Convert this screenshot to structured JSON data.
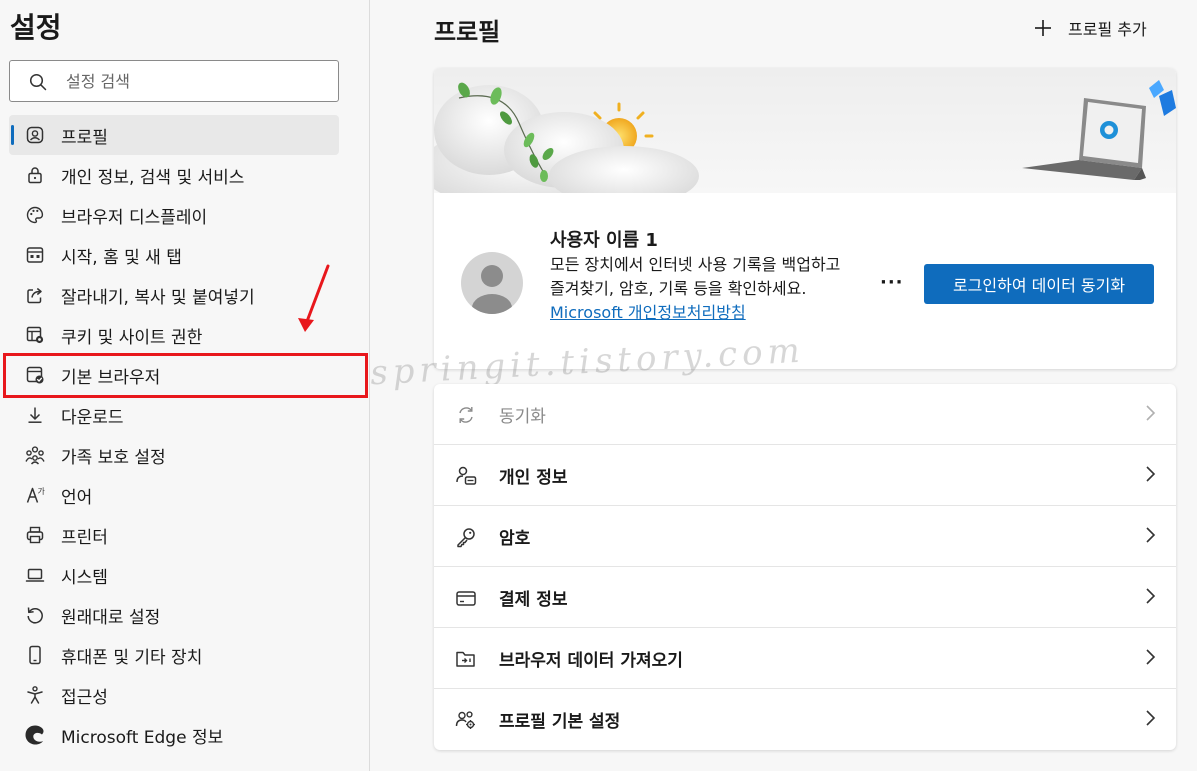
{
  "sidebar": {
    "title": "설정",
    "search": {
      "placeholder": "설정 검색",
      "value": ""
    },
    "items": [
      {
        "label": "프로필",
        "icon": "profile-icon",
        "active": true
      },
      {
        "label": "개인 정보, 검색 및 서비스",
        "icon": "lock-icon"
      },
      {
        "label": "브라우저 디스플레이",
        "icon": "palette-icon"
      },
      {
        "label": "시작, 홈 및 새 탭",
        "icon": "start-home-icon"
      },
      {
        "label": "잘라내기, 복사 및 붙여넣기",
        "icon": "share-icon"
      },
      {
        "label": "쿠키 및 사이트 권한",
        "icon": "cookie-settings-icon"
      },
      {
        "label": "기본 브라우저",
        "icon": "default-browser-icon",
        "highlighted": true
      },
      {
        "label": "다운로드",
        "icon": "download-icon"
      },
      {
        "label": "가족 보호 설정",
        "icon": "family-icon"
      },
      {
        "label": "언어",
        "icon": "language-icon"
      },
      {
        "label": "프린터",
        "icon": "printer-icon"
      },
      {
        "label": "시스템",
        "icon": "laptop-icon"
      },
      {
        "label": "원래대로 설정",
        "icon": "reset-icon"
      },
      {
        "label": "휴대폰 및 기타 장치",
        "icon": "phone-icon"
      },
      {
        "label": "접근성",
        "icon": "accessibility-icon"
      },
      {
        "label": "Microsoft Edge 정보",
        "icon": "edge-logo-icon"
      }
    ]
  },
  "main": {
    "title": "프로필",
    "add_profile_label": "프로필 추가",
    "profile": {
      "name": "사용자 이름 1",
      "description": "모든 장치에서 인터넷 사용 기록을 백업하고 즐겨찾기, 암호, 기록 등을 확인하세요.",
      "privacy_link": "Microsoft 개인정보처리방침",
      "more_label": "···",
      "sync_button": "로그인하여 데이터 동기화"
    },
    "rows": [
      {
        "label": "동기화",
        "icon": "sync-icon",
        "disabled": true
      },
      {
        "label": "개인 정보",
        "icon": "personal-info-icon"
      },
      {
        "label": "암호",
        "icon": "key-icon"
      },
      {
        "label": "결제 정보",
        "icon": "credit-card-icon"
      },
      {
        "label": "브라우저 데이터 가져오기",
        "icon": "import-data-icon"
      },
      {
        "label": "프로필 기본 설정",
        "icon": "profile-settings-icon"
      }
    ]
  },
  "watermark": "springit.tistory.com",
  "colors": {
    "accent": "#0f6cbd",
    "highlight": "#e8171c",
    "sidebar_bg": "#f7f7f7"
  }
}
